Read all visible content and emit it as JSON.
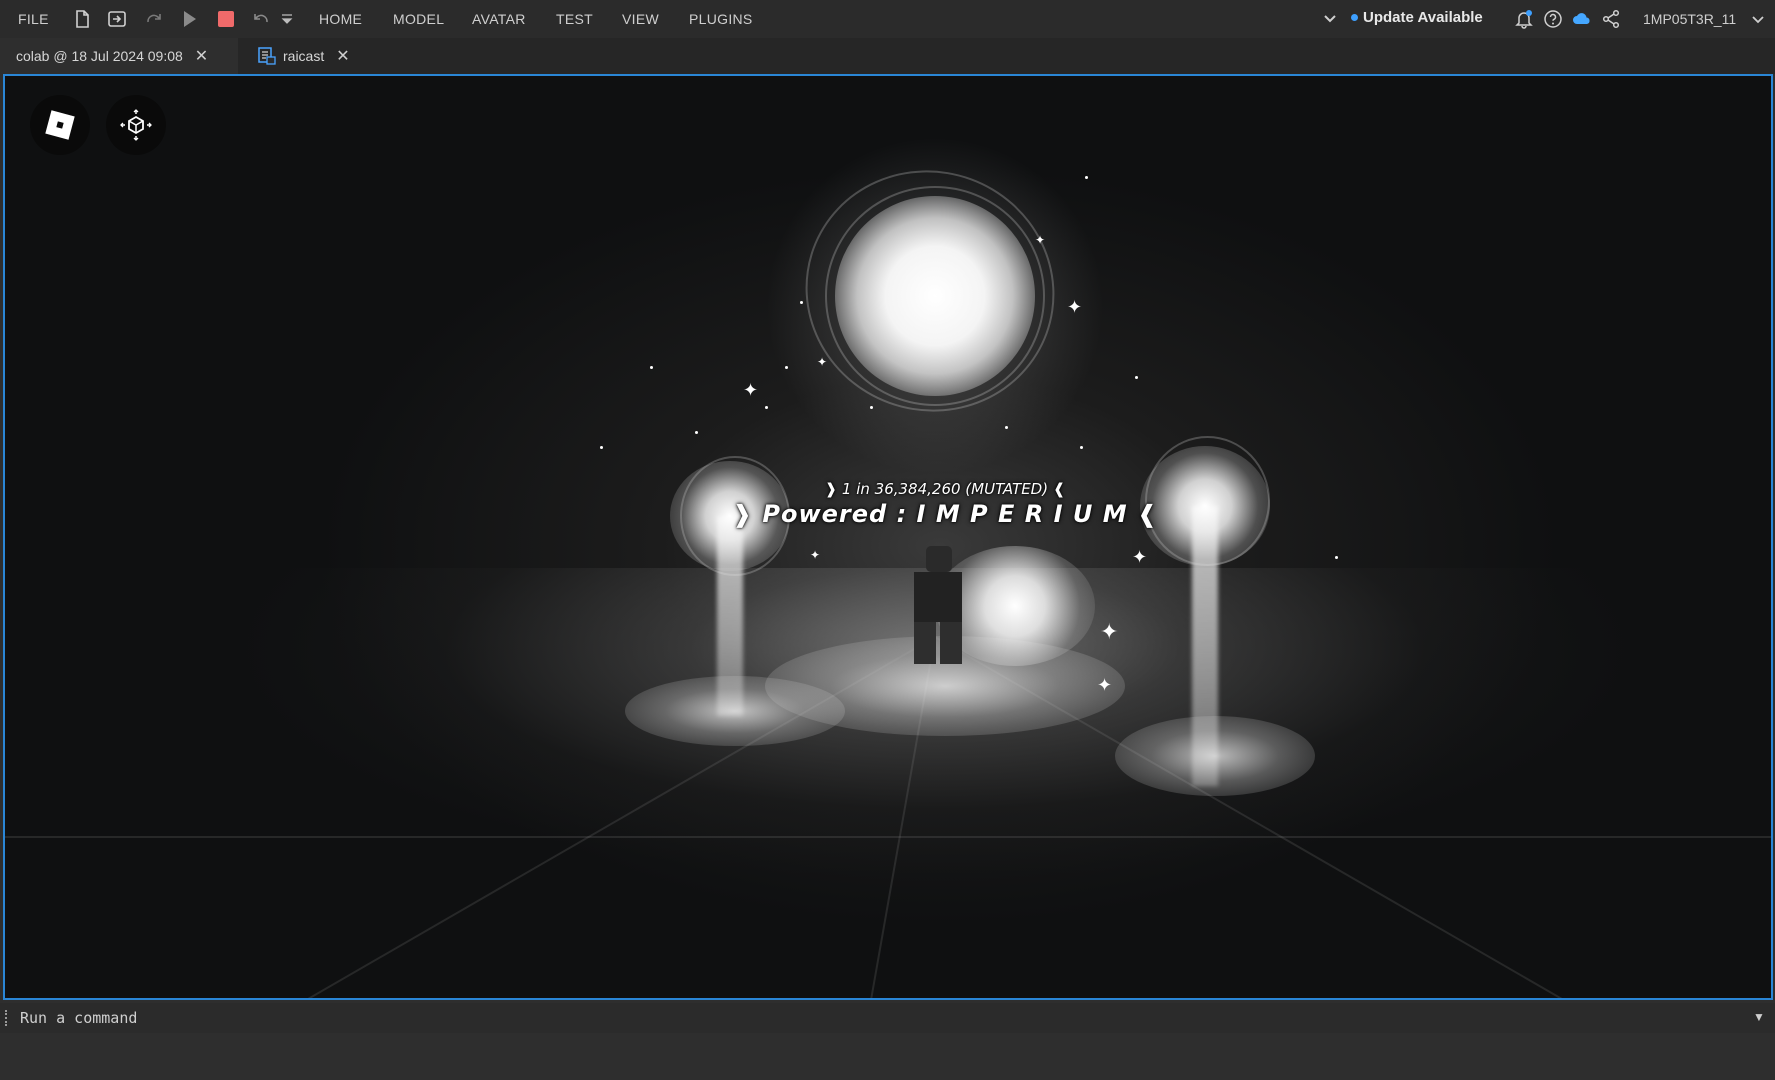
{
  "menu": {
    "file": "FILE",
    "items": [
      "HOME",
      "MODEL",
      "AVATAR",
      "TEST",
      "VIEW",
      "PLUGINS"
    ]
  },
  "toolbar_icons": [
    "new-file-icon",
    "open-file-icon",
    "redo-icon",
    "play-icon",
    "stop-icon",
    "undo-icon",
    "quick-access-dropdown-icon"
  ],
  "status": {
    "update_text": "Update Available",
    "update_dot_color": "#3ea0ff",
    "username": "1MP05T3R_11"
  },
  "right_icons": [
    "collapse-ribbon-icon",
    "notification-bell-icon",
    "help-icon",
    "cloud-icon",
    "share-icon",
    "account-dropdown-icon"
  ],
  "tabs": [
    {
      "label": "colab @ 18 Jul 2024 09:08",
      "active": true
    },
    {
      "label": "raicast",
      "active": false,
      "icon": "script-icon"
    }
  ],
  "viewport": {
    "border_color": "#2a86d6",
    "buttons": [
      "roblox-logo-icon",
      "freecam-icon"
    ],
    "rarity_text": "❱ 1 in 36,384,260 (MUTATED) ❰",
    "aura_text": "❱ Powered : I M P E R I U M ❰"
  },
  "command_bar": {
    "placeholder": "Run a command"
  }
}
